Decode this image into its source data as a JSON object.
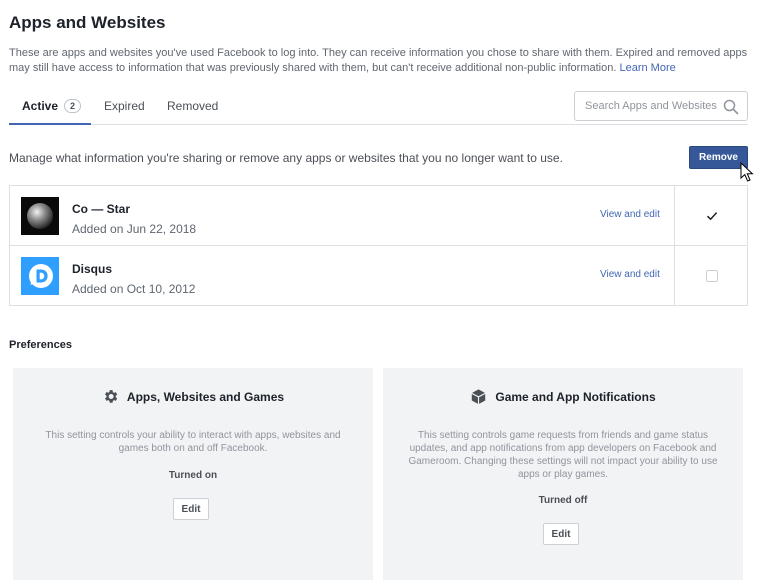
{
  "header": {
    "title": "Apps and Websites",
    "intro": "These are apps and websites you've used Facebook to log into. They can receive information you chose to share with them. Expired and removed apps may still have access to information that was previously shared with them, but can't receive additional non-public information.",
    "learn_more": "Learn More"
  },
  "tabs": [
    {
      "label": "Active",
      "count": "2",
      "active": true
    },
    {
      "label": "Expired",
      "active": false
    },
    {
      "label": "Removed",
      "active": false
    }
  ],
  "search": {
    "placeholder": "Search Apps and Websites",
    "value": ""
  },
  "manage": {
    "text": "Manage what information you're sharing or remove any apps or websites that you no longer want to use.",
    "remove_label": "Remove"
  },
  "apps": [
    {
      "name": "Co — Star",
      "date": "Added on Jun 22, 2018",
      "link": "View and edit",
      "checked": true,
      "icon": "costar-logo"
    },
    {
      "name": "Disqus",
      "date": "Added on Oct 10, 2012",
      "link": "View and edit",
      "checked": false,
      "icon": "disqus-logo"
    }
  ],
  "preferences": {
    "title": "Preferences",
    "cards": [
      {
        "title": "Apps, Websites and Games",
        "icon": "gear-icon",
        "description": "This setting controls your ability to interact with apps, websites and games both on and off Facebook.",
        "status": "Turned on",
        "edit_label": "Edit"
      },
      {
        "title": "Game and App Notifications",
        "icon": "cube-icon",
        "description": "This setting controls game requests from friends and game status updates, and app notifications from app developers on Facebook and Gameroom. Changing these settings will not impact your ability to use apps or play games.",
        "status": "Turned off",
        "edit_label": "Edit"
      }
    ]
  },
  "colors": {
    "accent": "#4267b2",
    "button": "#365899",
    "card_bg": "#f2f3f5",
    "disqus": "#2e9fff"
  }
}
